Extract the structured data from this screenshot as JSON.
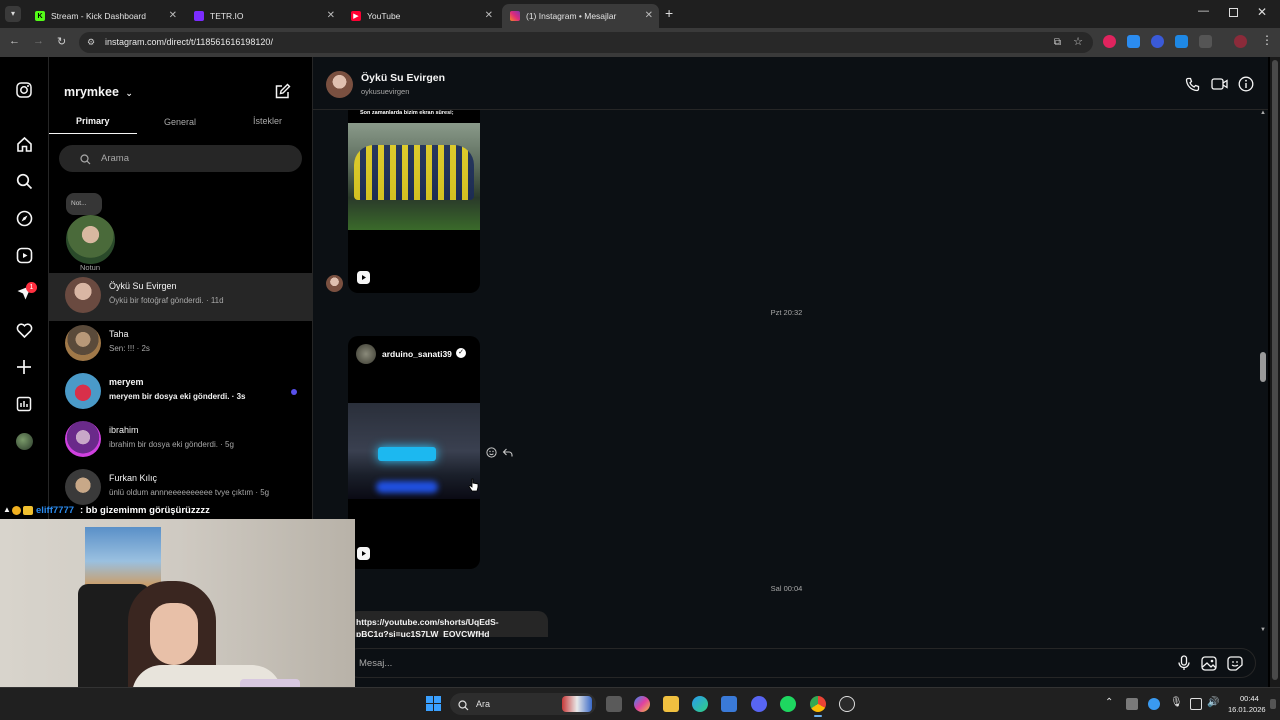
{
  "browser": {
    "tabs": [
      {
        "label": "Stream - Kick Dashboard",
        "favicon": "kick-icon",
        "color": "#53fc18"
      },
      {
        "label": "TETR.IO",
        "favicon": "tetrio-icon",
        "color": "#7b2cff"
      },
      {
        "label": "YouTube",
        "favicon": "youtube-icon",
        "color": "#ff0033"
      },
      {
        "label": "(1) Instagram • Mesajlar",
        "favicon": "instagram-icon",
        "color": "#e1306c"
      }
    ],
    "url": "instagram.com/direct/t/118561616198120/"
  },
  "inbox": {
    "username": "mrymkee",
    "tabs": [
      "Primary",
      "General",
      "İstekler"
    ],
    "search_placeholder": "Arama",
    "note_bubble": "Not...",
    "note_label": "Notun",
    "notification_badge": "1",
    "conversations": [
      {
        "name": "Öykü Su Evirgen",
        "preview": "Öykü bir fotoğraf gönderdi. · 11d",
        "unread": false
      },
      {
        "name": "Taha",
        "preview": "Sen: !!! · 2s",
        "unread": false
      },
      {
        "name": "meryem",
        "preview": "meryem bir dosya eki gönderdi. · 3s",
        "unread": true
      },
      {
        "name": "ibrahim",
        "preview": "ibrahim bir dosya eki gönderdi. · 5g",
        "unread": false
      },
      {
        "name": "Furkan Kılıç",
        "preview": "ünlü oldum annneeeeeeeeee tvye çıktım · 5g",
        "unread": false
      }
    ]
  },
  "chat": {
    "contact_name": "Öykü Su Evirgen",
    "contact_handle": "oykusuevirgen",
    "reel1_caption": "Son zamanlarda bizim ekran süresi;",
    "timestamp1": "Pzt 20:32",
    "reel2_author": "arduino_sanati39",
    "timestamp2": "Sal 00:04",
    "link_line1": "https://youtube.com/shorts/UqEdS-",
    "link_line2": "pBC1g?si=uc1S7LW_EOVCWfHd",
    "composer_placeholder": "Mesaj..."
  },
  "stream_overlay": {
    "chat_user": "eliff7777",
    "chat_message": ": bb gizemimm görüşürüzzzz"
  },
  "taskbar": {
    "search_label": "Ara",
    "time": "00:44",
    "date": "16.01.2026"
  }
}
